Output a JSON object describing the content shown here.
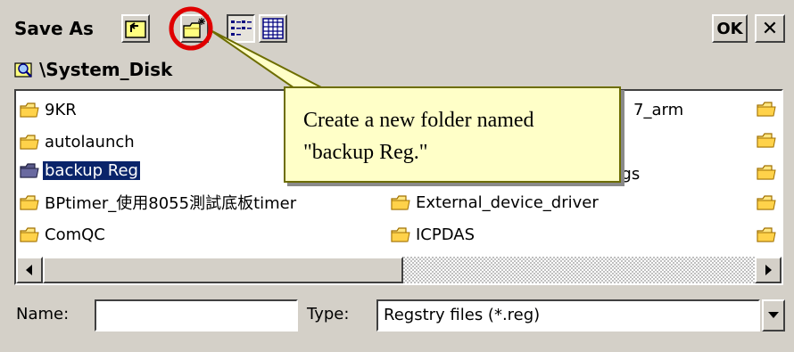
{
  "dialog": {
    "title": "Save As",
    "ok_label": "OK",
    "close_label": "✕",
    "path": "\\System_Disk"
  },
  "files": {
    "left_column": [
      "9KR",
      "autolaunch",
      "backup Reg",
      "BPtimer_使用8055測試底板timer",
      "ComQC"
    ],
    "right_column": [
      "7_arm",
      "",
      "ings",
      "External_device_driver",
      "ICPDAS"
    ],
    "selected": "backup Reg"
  },
  "form": {
    "name_label": "Name:",
    "name_value": "",
    "type_label": "Type:",
    "type_value": "Regstry files (*.reg)"
  },
  "callout": {
    "line1": "Create a new folder named",
    "line2": "\"backup Reg.\""
  },
  "colors": {
    "dialog_bg": "#d4d0c8",
    "selection": "#0a246a",
    "callout_bg": "#ffffc8",
    "highlight_ring": "#e00000"
  }
}
